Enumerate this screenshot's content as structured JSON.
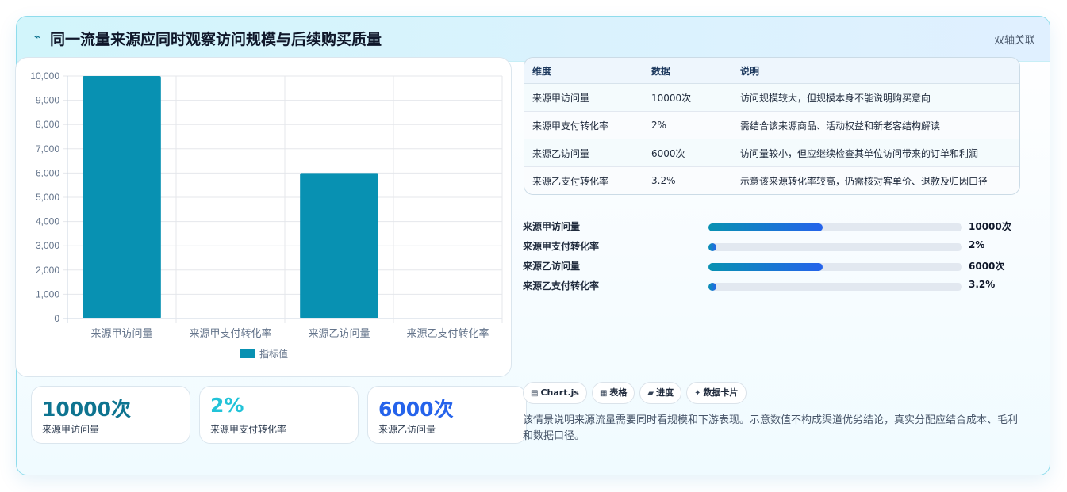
{
  "header": {
    "title": "同一流量来源应同时观察访问规模与后续购买质量",
    "title_icon": "⌁",
    "badge": "双轴关联"
  },
  "chart_data": {
    "type": "bar",
    "categories": [
      "来源甲访问量",
      "来源甲支付转化率",
      "来源乙访问量",
      "来源乙支付转化率"
    ],
    "series": [
      {
        "name": "指标值",
        "values": [
          10000,
          2,
          6000,
          3.2
        ],
        "color": "#0891b2"
      }
    ],
    "ylim": [
      0,
      10000
    ],
    "yticks": [
      "0",
      "1,000",
      "2,000",
      "3,000",
      "4,000",
      "5,000",
      "6,000",
      "7,000",
      "8,000",
      "9,000",
      "10,000"
    ],
    "legend": "bottom",
    "grid": true
  },
  "stats": [
    {
      "value": "10000次",
      "label": "来源甲访问量",
      "color": "#0e7490"
    },
    {
      "value": "2%",
      "label": "来源甲支付转化率",
      "color": "#22c3d8"
    },
    {
      "value": "6000次",
      "label": "来源乙访问量",
      "color": "#2563eb"
    }
  ],
  "table": {
    "headers": [
      "维度",
      "数据",
      "说明"
    ],
    "rows": [
      [
        "来源甲访问量",
        "10000次",
        "访问规模较大，但规模本身不能说明购买意向"
      ],
      [
        "来源甲支付转化率",
        "2%",
        "需结合该来源商品、活动权益和新老客结构解读"
      ],
      [
        "来源乙访问量",
        "6000次",
        "访问量较小，但应继续检查其单位访问带来的订单和利润"
      ],
      [
        "来源乙支付转化率",
        "3.2%",
        "示意该来源转化率较高，仍需核对客单价、退款及归因口径"
      ]
    ]
  },
  "progress": [
    {
      "label": "来源甲访问量",
      "value": "10000次",
      "fraction": 0.45
    },
    {
      "label": "来源甲支付转化率",
      "value": "2%",
      "fraction": 0.03
    },
    {
      "label": "来源乙访问量",
      "value": "6000次",
      "fraction": 0.45
    },
    {
      "label": "来源乙支付转化率",
      "value": "3.2%",
      "fraction": 0.03
    }
  ],
  "chips": [
    {
      "icon": "▤",
      "label": "Chart.js"
    },
    {
      "icon": "▦",
      "label": "表格"
    },
    {
      "icon": "▰",
      "label": "进度"
    },
    {
      "icon": "✦",
      "label": "数据卡片"
    }
  ],
  "description": "该情景说明来源流量需要同时看规模和下游表现。示意数值不构成渠道优劣结论，真实分配应结合成本、毛利和数据口径。"
}
